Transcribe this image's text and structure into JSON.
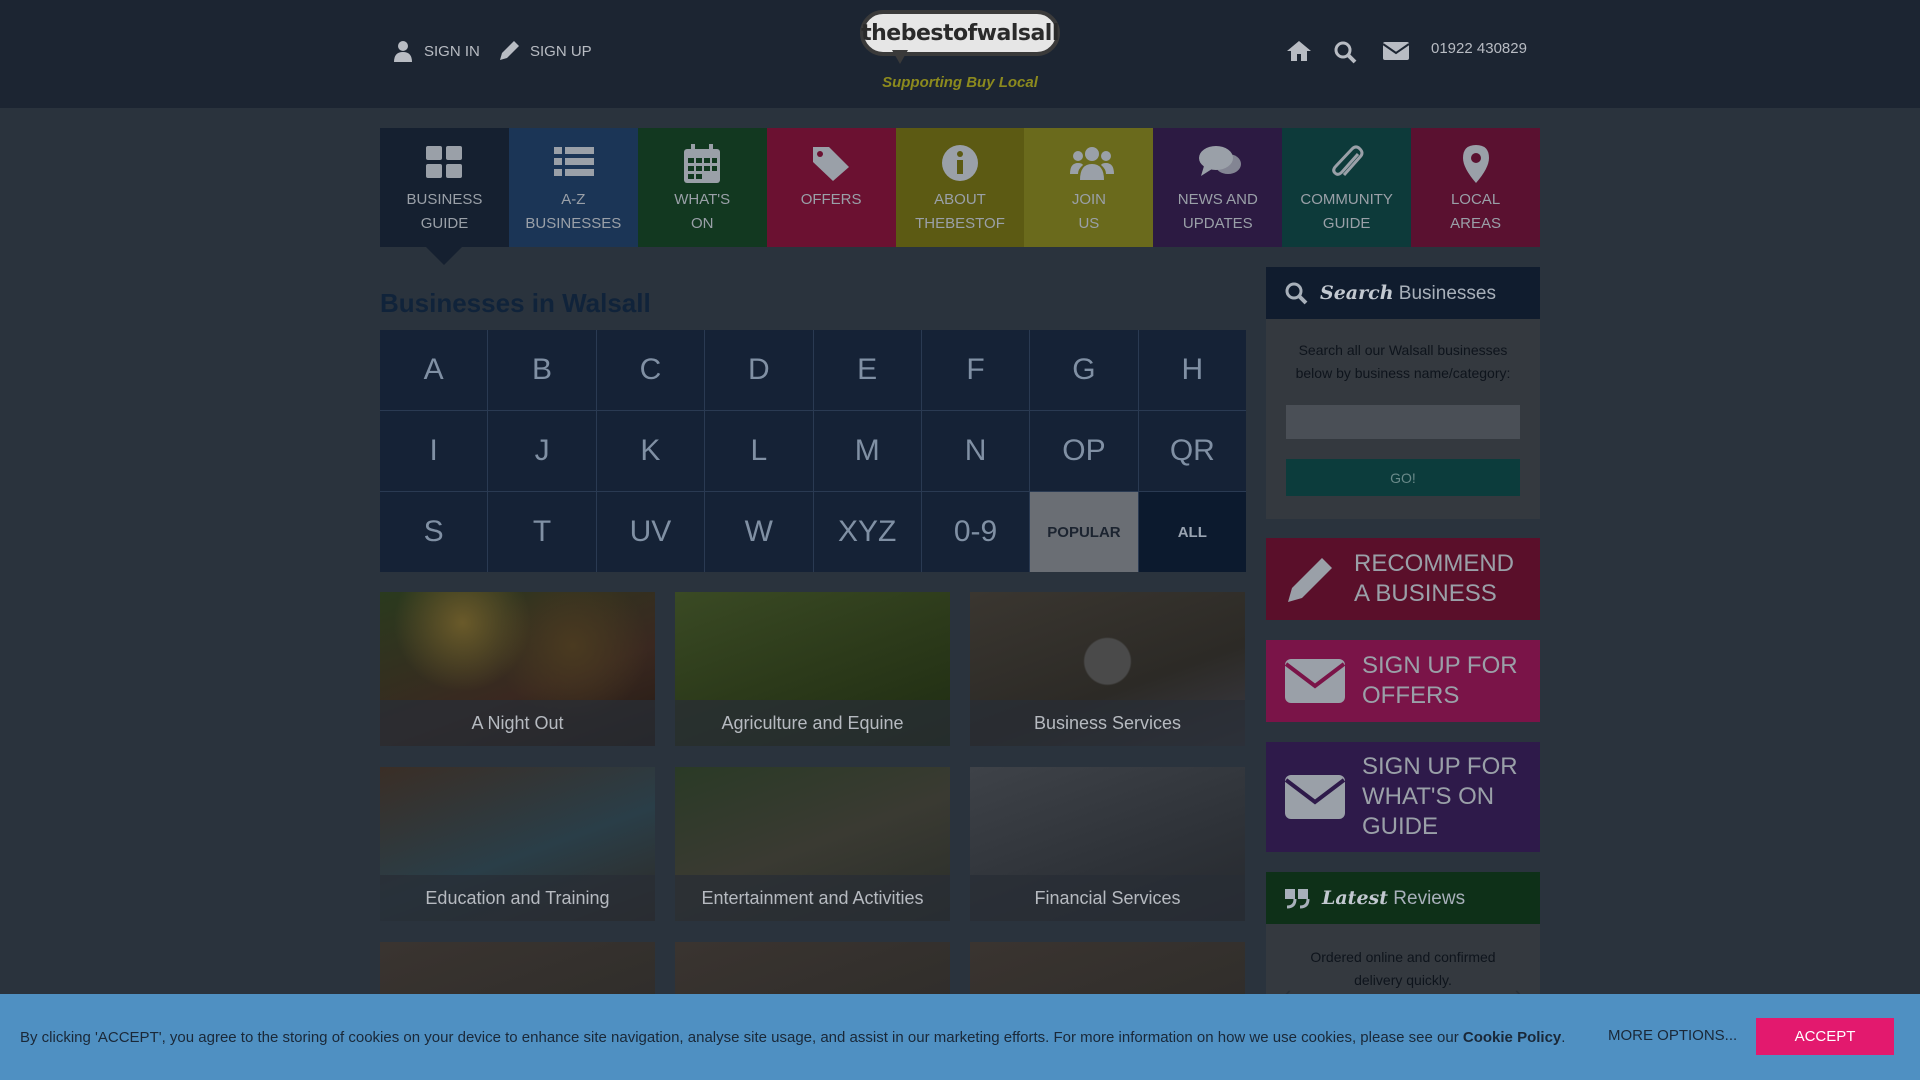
{
  "header": {
    "sign_in": "SIGN IN",
    "sign_up": "SIGN UP",
    "logo_text": "thebestofwalsall",
    "logo_tagline": "Supporting Buy Local",
    "phone": "01922 430829"
  },
  "nav": {
    "items": [
      {
        "label": "BUSINESS\nGUIDE",
        "icon": "grid-icon",
        "color": "#152030"
      },
      {
        "label": "A-Z\nBUSINESSES",
        "icon": "list-icon",
        "color": "#1b3556"
      },
      {
        "label": "WHAT'S\nON",
        "icon": "calendar-icon",
        "color": "#123820"
      },
      {
        "label": "OFFERS",
        "icon": "tags-icon",
        "color": "#6b1131"
      },
      {
        "label": "ABOUT\nTHEBESTOF",
        "icon": "info-icon",
        "color": "#5c5a13"
      },
      {
        "label": "JOIN\nUS",
        "icon": "users-icon",
        "color": "#6a6a1c"
      },
      {
        "label": "NEWS AND\nUPDATES",
        "icon": "comments-icon",
        "color": "#2c1a42"
      },
      {
        "label": "COMMUNITY\nGUIDE",
        "icon": "paperclip-icon",
        "color": "#0d3a3a"
      },
      {
        "label": "LOCAL\nAREAS",
        "icon": "map-marker-icon",
        "color": "#5a1130"
      }
    ]
  },
  "main": {
    "title": "Businesses in Walsall",
    "letters": [
      "A",
      "B",
      "C",
      "D",
      "E",
      "F",
      "G",
      "H",
      "I",
      "J",
      "K",
      "L",
      "M",
      "N",
      "OP",
      "QR",
      "S",
      "T",
      "UV",
      "W",
      "XYZ",
      "0-9",
      "POPULAR",
      "ALL"
    ],
    "categories": [
      "A Night Out",
      "Agriculture and Equine",
      "Business Services",
      "Education and Training",
      "Entertainment and Activities",
      "Financial Services"
    ]
  },
  "sidebar": {
    "search_head_bold": "Search",
    "search_head_rest": "Businesses",
    "search_desc": "Search all our Walsall businesses below by business name/category:",
    "search_placeholder": "",
    "go_label": "GO!",
    "recommend": "RECOMMEND\nA BUSINESS",
    "signup_offers": "SIGN UP FOR\nOFFERS",
    "signup_whatson": "SIGN UP FOR\nWHAT'S ON\nGUIDE",
    "reviews_head_bold": "Latest",
    "reviews_head_rest": "Reviews",
    "review_text": "Ordered online and confirmed delivery quickly."
  },
  "cookie": {
    "text": "By clicking 'ACCEPT', you agree to the storing of cookies on your device to enhance site navigation, analyse site usage, and assist in our marketing efforts. For more information on how we use cookies, please see our ",
    "policy_link": "Cookie Policy",
    "period": ".",
    "more_options": "MORE OPTIONS...",
    "accept": "ACCEPT"
  },
  "colors": {
    "recommend_bg": "#5a0f2a",
    "offers_bg": "#7a1448",
    "whatson_bg": "#2e1a4a",
    "search_head_bg": "#101c2e",
    "reviews_head_bg": "#0e3018",
    "accept_bg": "#e3196e"
  }
}
